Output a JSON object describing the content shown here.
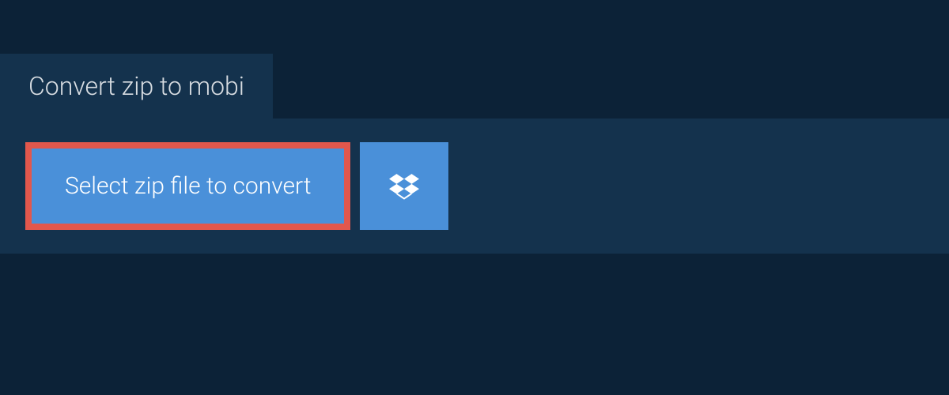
{
  "tab": {
    "title": "Convert zip to mobi"
  },
  "actions": {
    "select_file_label": "Select zip file to convert",
    "dropbox_icon_name": "dropbox-icon"
  },
  "colors": {
    "background": "#0c2237",
    "panel": "#14324d",
    "button": "#4a90d9",
    "highlight_border": "#e2574c",
    "text_light": "#d8dde2",
    "text_white": "#ffffff"
  }
}
